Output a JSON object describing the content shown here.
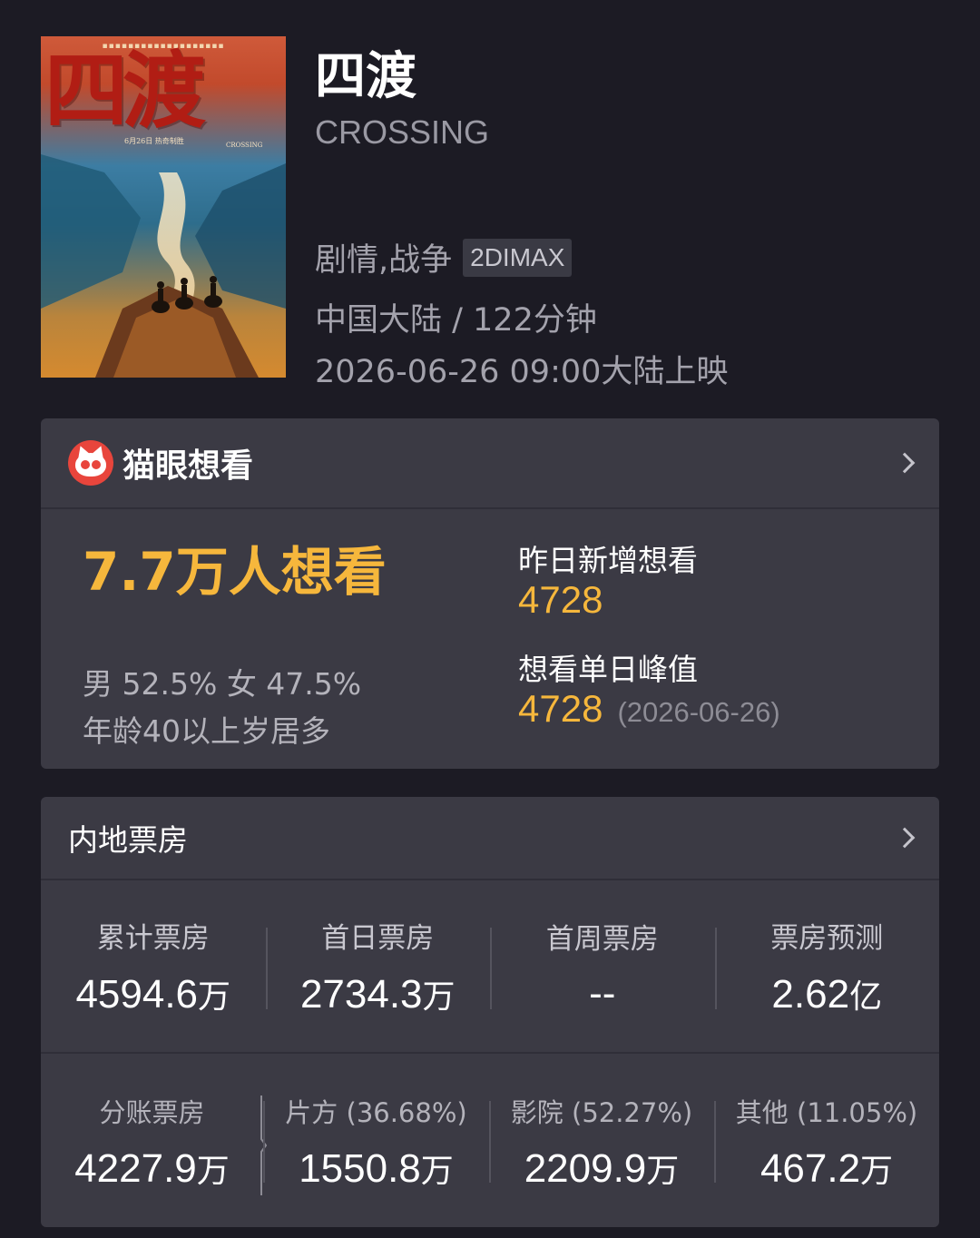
{
  "movie": {
    "title": "四渡",
    "english_title": "CROSSING",
    "genre": "剧情,战争",
    "format": "2DIMAX",
    "region_runtime": "中国大陆 / 122分钟",
    "release": "2026-06-26 09:00大陆上映",
    "poster": {
      "title_art": "四渡",
      "date_text": "6月26日 热奇制胜",
      "english_text": "CROSSING"
    }
  },
  "wish": {
    "brand": "猫眼想看",
    "total": "7.7万人想看",
    "gender": "男 52.5% 女 47.5%",
    "age": "年龄40以上岁居多",
    "yesterday_label": "昨日新增想看",
    "yesterday_value": "4728",
    "peak_label": "想看单日峰值",
    "peak_value": "4728",
    "peak_date": "(2026-06-26)"
  },
  "box_office": {
    "title": "内地票房",
    "row1": [
      {
        "label": "累计票房",
        "value": "4594.6",
        "unit": "万"
      },
      {
        "label": "首日票房",
        "value": "2734.3",
        "unit": "万"
      },
      {
        "label": "首周票房",
        "value": "--",
        "unit": ""
      },
      {
        "label": "票房预测",
        "value": "2.62",
        "unit": "亿"
      }
    ],
    "row2": [
      {
        "label": "分账票房",
        "value": "4227.9",
        "unit": "万"
      },
      {
        "label": "片方 (36.68%)",
        "value": "1550.8",
        "unit": "万"
      },
      {
        "label": "影院 (52.27%)",
        "value": "2209.9",
        "unit": "万"
      },
      {
        "label": "其他 (11.05%)",
        "value": "467.2",
        "unit": "万"
      }
    ]
  },
  "colors": {
    "background": "#1c1b24",
    "card": "#3b3a44",
    "accent": "#f6b73c",
    "brand_red": "#e8453c"
  }
}
